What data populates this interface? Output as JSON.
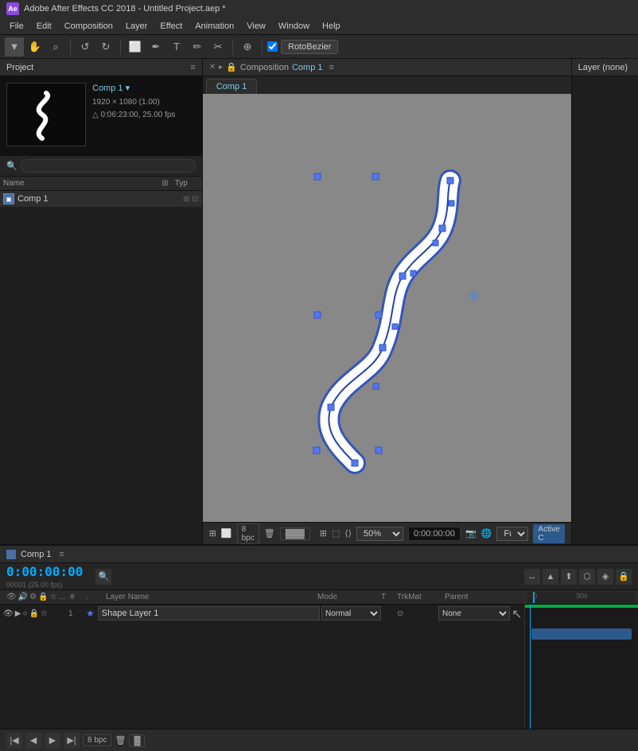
{
  "app": {
    "title": "Adobe After Effects CC 2018 - Untitled Project.aep *",
    "ae_icon": "Ae"
  },
  "menu": {
    "items": [
      "File",
      "Edit",
      "Composition",
      "Layer",
      "Effect",
      "Animation",
      "View",
      "Window",
      "Help"
    ]
  },
  "toolbar": {
    "tools": [
      "▼",
      "✋",
      "🔍",
      "↩",
      "↩",
      "⬜",
      "🖊",
      "T",
      "✏",
      "🖉",
      "▶▶",
      "⊕"
    ],
    "roto_label": "RotoBezier"
  },
  "project": {
    "title": "Project",
    "comp_name": "Comp 1",
    "comp_version": "▾",
    "comp_resolution": "1920 × 1080 (1.00)",
    "comp_duration": "△ 0:06:23:00, 25.00 fps",
    "search_placeholder": "🔍",
    "columns": {
      "name": "Name",
      "typ": "Typ"
    },
    "files": [
      {
        "name": "Comp 1",
        "type": "comp"
      }
    ]
  },
  "composition": {
    "title": "Composition",
    "comp_tab": "Comp 1",
    "layer_panel": "Layer (none)",
    "zoom": "50%",
    "timecode_display": "0:00:00:00",
    "full_label": "Full",
    "active_label": "Active C"
  },
  "timeline": {
    "title": "Comp 1",
    "timecode": "0:00:00:00",
    "frame_count": "00001 (25.00 fps)",
    "ruler_marks": [
      "",
      "30s"
    ],
    "columns": {
      "icons": "",
      "hash": "#",
      "label": ".",
      "name": "Layer Name",
      "mode": "Mode",
      "t": "T",
      "trkmat": "TrkMat",
      "parent": "Parent"
    },
    "layers": [
      {
        "num": "1",
        "name": "Shape Layer 1",
        "mode": "Normal",
        "parent": "None"
      }
    ],
    "bpc": "8 bpc"
  }
}
